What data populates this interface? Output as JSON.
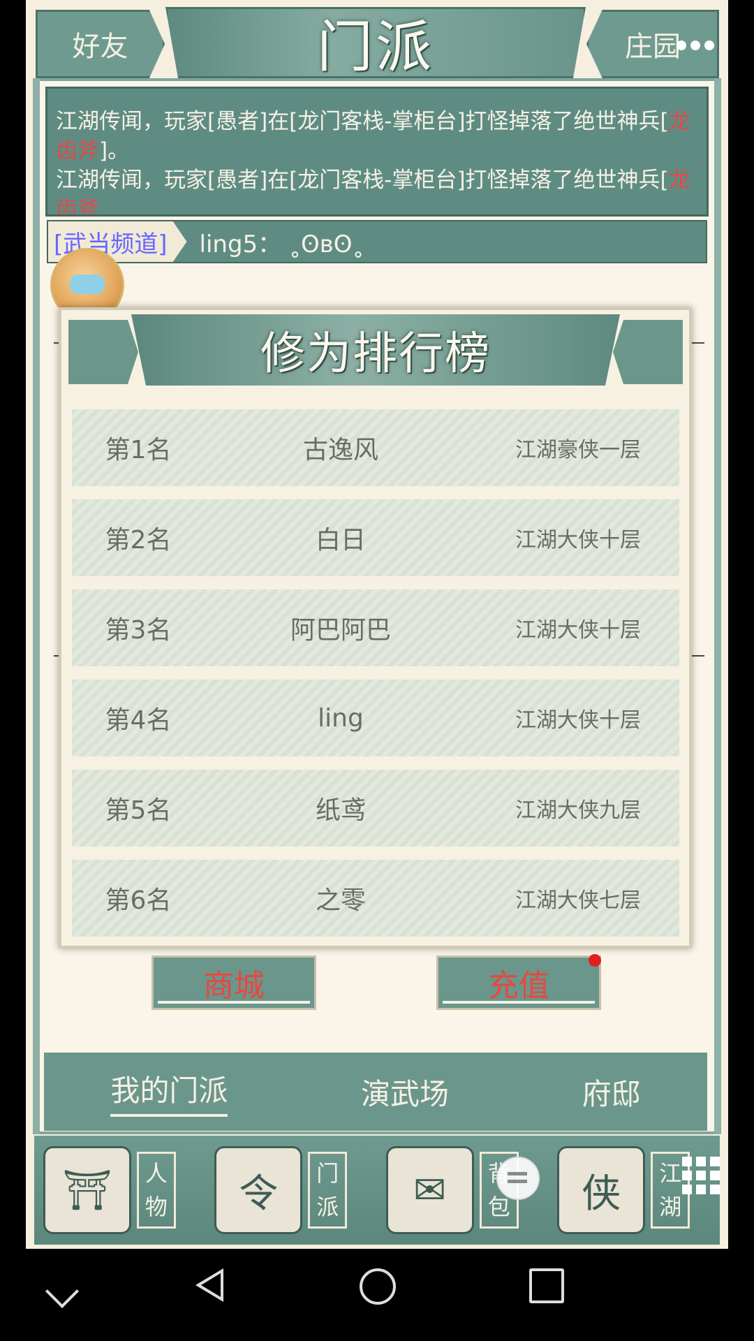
{
  "header": {
    "left_tab": "好友",
    "title": "门派",
    "right_tab": "庄园"
  },
  "news": {
    "line1_prefix": "江湖传闻，玩家[愚者]在[龙门客栈-掌柜台]打怪掉落了绝世神兵[",
    "line1_item": "龙齿斧",
    "line1_suffix": "]。",
    "line2_prefix": "江湖传闻，玩家[愚者]在[龙门客栈-掌柜台]打怪掉落了绝世神兵[",
    "line2_item": "龙齿斧"
  },
  "chat": {
    "channel": "[武当频道]",
    "message": "ling5：  ˳ʘвʘ˳"
  },
  "modal": {
    "title": "修为排行榜",
    "rows": [
      {
        "rank": "第1名",
        "name": "古逸风",
        "level": "江湖豪侠一层"
      },
      {
        "rank": "第2名",
        "name": "白日",
        "level": "江湖大侠十层"
      },
      {
        "rank": "第3名",
        "name": "阿巴阿巴",
        "level": "江湖大侠十层"
      },
      {
        "rank": "第4名",
        "name": "ling",
        "level": "江湖大侠十层"
      },
      {
        "rank": "第5名",
        "name": "纸鸢",
        "level": "江湖大侠九层"
      },
      {
        "rank": "第6名",
        "name": "之零",
        "level": "江湖大侠七层"
      }
    ]
  },
  "buttons": {
    "shop": "商城",
    "recharge": "充值"
  },
  "subtabs": {
    "my_sect": "我的门派",
    "arena": "演武场",
    "mansion": "府邸"
  },
  "bottom_nav": {
    "character": "人物",
    "sect": "门派",
    "bag": "背包",
    "jianghu": "江湖",
    "sect_icon_glyph": "令",
    "jianghu_icon_glyph": "侠"
  },
  "colors": {
    "accent": "#6b968b",
    "highlight_red": "#e04a4a",
    "channel_blue": "#6767ff"
  }
}
